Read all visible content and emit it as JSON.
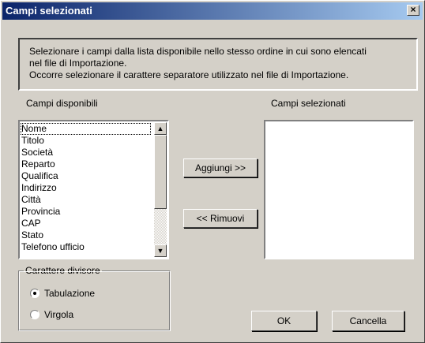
{
  "window": {
    "title": "Campi selezionati",
    "close_glyph": "×"
  },
  "info": {
    "line1": "Selezionare i campi dalla lista disponibile nello stesso ordine in cui sono elencati",
    "line2": "nel file di Importazione.",
    "line3": "Occorre selezionare il carattere separatore utilizzato nel file di Importazione."
  },
  "available": {
    "label": "Campi disponibili",
    "items": [
      "Nome",
      "Titolo",
      "Società",
      "Reparto",
      "Qualifica",
      "Indirizzo",
      "Città",
      "Provincia",
      "CAP",
      "Stato",
      "Telefono ufficio"
    ],
    "selected_index": 0
  },
  "selected": {
    "label": "Campi selezionati",
    "items": []
  },
  "buttons": {
    "add": "Aggiungi >>",
    "remove": "<< Rimuovi",
    "ok": "OK",
    "cancel": "Cancella"
  },
  "separator": {
    "label": "Carattere divisore",
    "options": [
      {
        "label": "Tabulazione",
        "checked": true
      },
      {
        "label": "Virgola",
        "checked": false
      }
    ]
  }
}
